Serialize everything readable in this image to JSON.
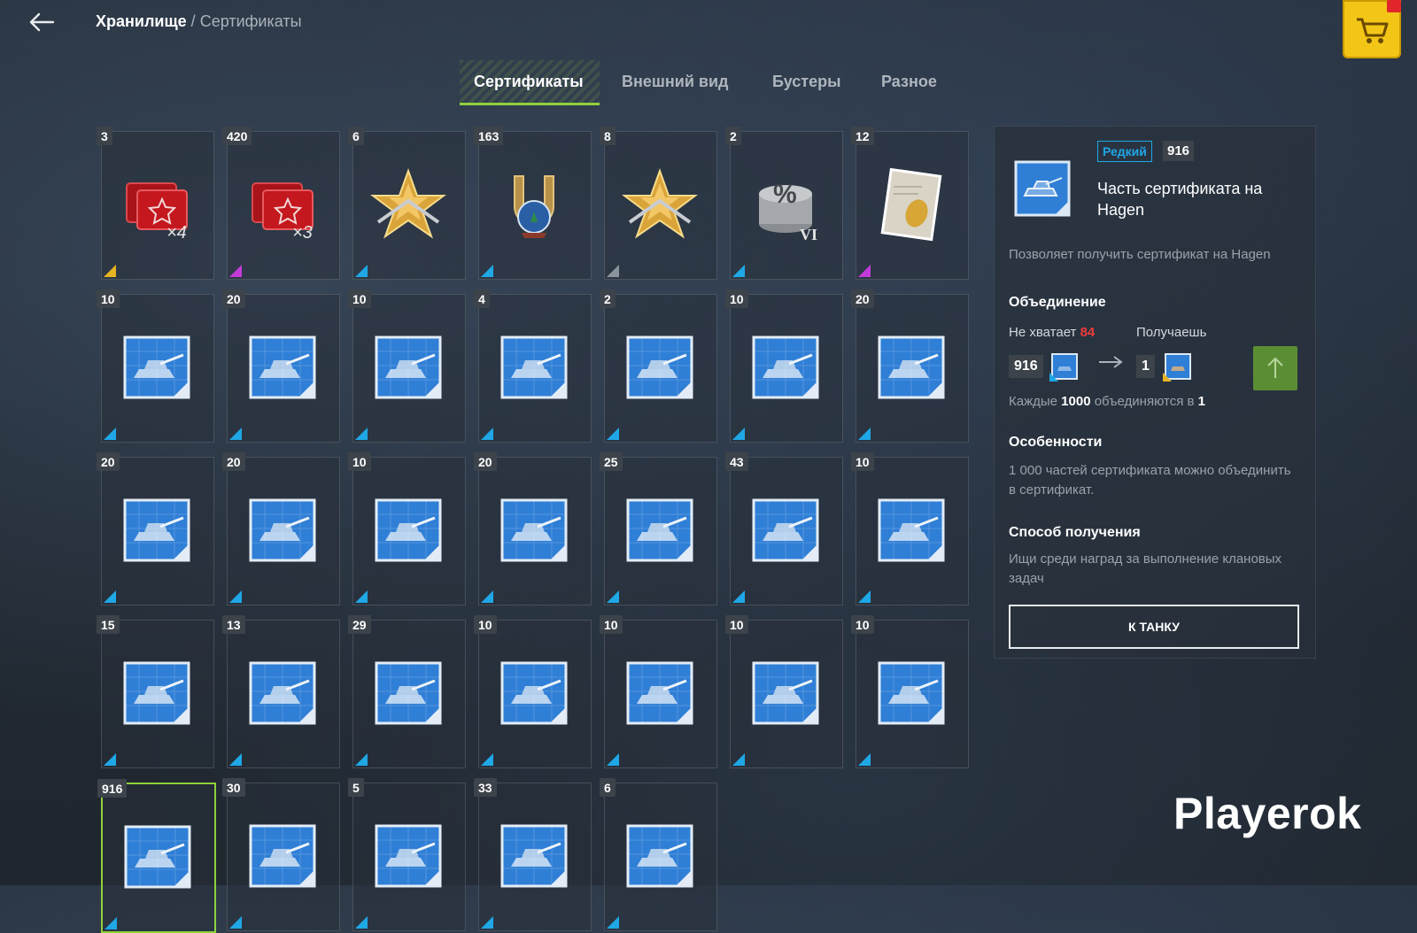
{
  "header": {
    "breadcrumb_root": "Хранилище",
    "breadcrumb_sep": "/",
    "breadcrumb_current": "Сертификаты"
  },
  "tabs": [
    {
      "label": "Сертификаты",
      "active": true
    },
    {
      "label": "Внешний вид",
      "active": false
    },
    {
      "label": "Бустеры",
      "active": false
    },
    {
      "label": "Разное",
      "active": false
    }
  ],
  "items": [
    {
      "count": "3",
      "icon": "red-cards-x4-icon",
      "rarity": "gold"
    },
    {
      "count": "420",
      "icon": "red-cards-x3-icon",
      "rarity": "purple"
    },
    {
      "count": "6",
      "icon": "gold-star-medal-icon",
      "rarity": "blue"
    },
    {
      "count": "163",
      "icon": "horseshoe-snowglobe-icon",
      "rarity": "blue"
    },
    {
      "count": "8",
      "icon": "gold-star-medal-icon",
      "rarity": "gray"
    },
    {
      "count": "2",
      "icon": "percent-coins-vi-icon",
      "rarity": "blue"
    },
    {
      "count": "12",
      "icon": "gold-certificate-icon",
      "rarity": "purple"
    },
    {
      "count": "10",
      "icon": "tank-blueprint-icon",
      "rarity": "blue"
    },
    {
      "count": "20",
      "icon": "tank-blueprint-icon",
      "rarity": "blue"
    },
    {
      "count": "10",
      "icon": "tank-blueprint-icon",
      "rarity": "blue"
    },
    {
      "count": "4",
      "icon": "tank-blueprint-icon",
      "rarity": "blue"
    },
    {
      "count": "2",
      "icon": "tank-blueprint-icon",
      "rarity": "blue"
    },
    {
      "count": "10",
      "icon": "tank-blueprint-icon",
      "rarity": "blue"
    },
    {
      "count": "20",
      "icon": "tank-blueprint-icon",
      "rarity": "blue"
    },
    {
      "count": "20",
      "icon": "tank-blueprint-icon",
      "rarity": "blue"
    },
    {
      "count": "20",
      "icon": "tank-blueprint-icon",
      "rarity": "blue"
    },
    {
      "count": "10",
      "icon": "tank-blueprint-icon",
      "rarity": "blue"
    },
    {
      "count": "20",
      "icon": "tank-blueprint-icon",
      "rarity": "blue"
    },
    {
      "count": "25",
      "icon": "tank-blueprint-icon",
      "rarity": "blue"
    },
    {
      "count": "43",
      "icon": "tank-blueprint-icon",
      "rarity": "blue"
    },
    {
      "count": "10",
      "icon": "tank-blueprint-icon",
      "rarity": "blue"
    },
    {
      "count": "15",
      "icon": "tank-blueprint-icon",
      "rarity": "blue"
    },
    {
      "count": "13",
      "icon": "tank-blueprint-icon",
      "rarity": "blue"
    },
    {
      "count": "29",
      "icon": "tank-blueprint-icon",
      "rarity": "blue"
    },
    {
      "count": "10",
      "icon": "tank-blueprint-icon",
      "rarity": "blue"
    },
    {
      "count": "10",
      "icon": "tank-blueprint-icon",
      "rarity": "blue"
    },
    {
      "count": "10",
      "icon": "tank-blueprint-icon",
      "rarity": "blue"
    },
    {
      "count": "10",
      "icon": "tank-blueprint-icon",
      "rarity": "blue"
    },
    {
      "count": "916",
      "icon": "tank-blueprint-icon",
      "rarity": "blue",
      "selected": true
    },
    {
      "count": "30",
      "icon": "tank-blueprint-icon",
      "rarity": "blue"
    },
    {
      "count": "5",
      "icon": "tank-blueprint-icon",
      "rarity": "blue"
    },
    {
      "count": "33",
      "icon": "tank-blueprint-icon",
      "rarity": "blue"
    },
    {
      "count": "6",
      "icon": "tank-blueprint-icon",
      "rarity": "blue"
    }
  ],
  "detail": {
    "rarity_label": "Редкий",
    "owned_count": "916",
    "title": "Часть сертификата на Hagen",
    "description": "Позволяет получить сертификат на Hagen",
    "merge_heading": "Объединение",
    "missing_label": "Не хватает",
    "missing_value": "84",
    "receive_label": "Получаешь",
    "from_count": "916",
    "to_count": "1",
    "each_prefix": "Каждые",
    "each_amount": "1000",
    "each_middle": "объединяются в",
    "each_result": "1",
    "features_heading": "Особенности",
    "features_text": "1 000 частей сертификата можно объединить в сертификат.",
    "obtain_heading": "Способ получения",
    "obtain_text": "Ищи среди наград за выполнение клановых задач",
    "cta_label": "К ТАНКУ"
  },
  "watermark": "Playerok",
  "colors": {
    "accent_green": "#8fd13b",
    "rare_blue": "#1fa7e6",
    "missing_red": "#ef3b3b",
    "shop_yellow": "#f3c517"
  }
}
